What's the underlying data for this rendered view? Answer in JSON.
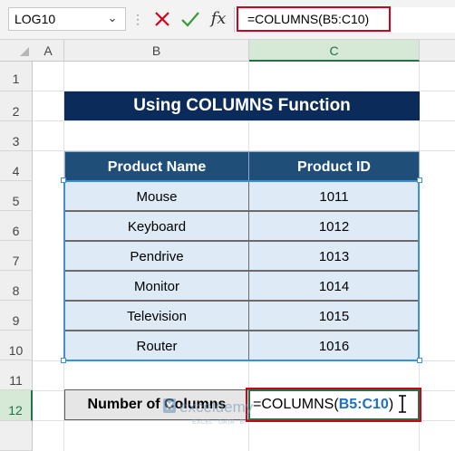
{
  "formula_bar": {
    "name_box": "LOG10",
    "fx_label": "fx",
    "formula": "=COLUMNS(B5:C10)"
  },
  "columns": [
    "A",
    "B",
    "C"
  ],
  "rows": [
    "1",
    "2",
    "3",
    "4",
    "5",
    "6",
    "7",
    "8",
    "9",
    "10",
    "11",
    "12"
  ],
  "sheet": {
    "title": "Using COLUMNS Function",
    "table": {
      "headers": [
        "Product Name",
        "Product ID"
      ],
      "rows": [
        {
          "name": "Mouse",
          "id": "1011"
        },
        {
          "name": "Keyboard",
          "id": "1012"
        },
        {
          "name": "Pendrive",
          "id": "1013"
        },
        {
          "name": "Monitor",
          "id": "1014"
        },
        {
          "name": "Television",
          "id": "1015"
        },
        {
          "name": "Router",
          "id": "1016"
        }
      ]
    },
    "result_label": "Number of Columns",
    "result_formula_prefix": "=COLUMNS(",
    "result_formula_ref": "B5:C10",
    "result_formula_suffix": ")"
  },
  "watermark": {
    "name": "exceldemy",
    "tagline": "EXCEL · DATA · BI"
  },
  "colors": {
    "title_bg": "#0b2c5a",
    "header_bg": "#1f4e79",
    "cell_bg": "#deebf7",
    "highlight_red": "#d0021b",
    "excel_green": "#217346",
    "range_blue": "#3e8fd6"
  }
}
